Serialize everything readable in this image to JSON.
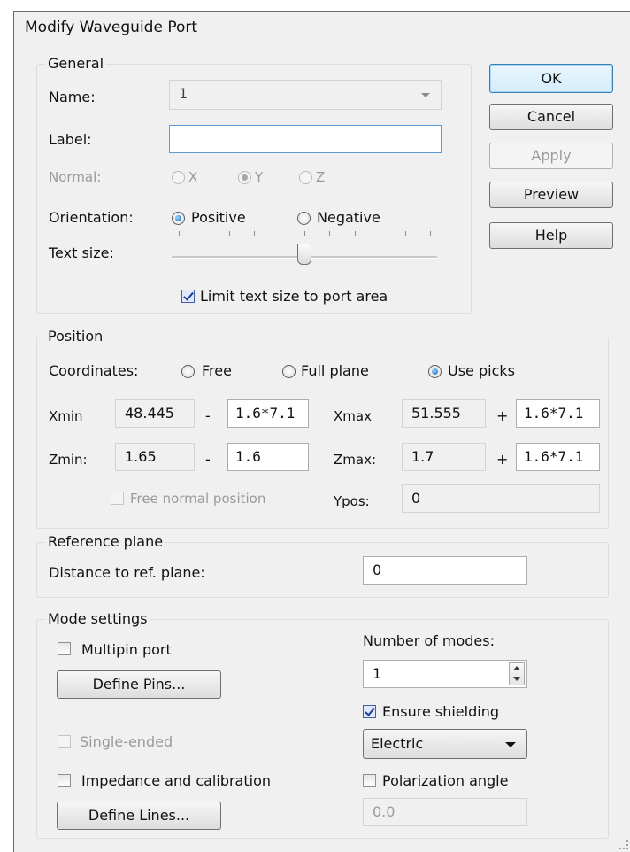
{
  "window": {
    "title": "Modify Waveguide Port"
  },
  "buttons": {
    "ok": "OK",
    "cancel": "Cancel",
    "apply": "Apply",
    "preview": "Preview",
    "help": "Help"
  },
  "general": {
    "legend": "General",
    "name_label": "Name:",
    "name_value": "1",
    "label_label": "Label:",
    "label_value": "",
    "normal_label": "Normal:",
    "normal_options": [
      "X",
      "Y",
      "Z"
    ],
    "normal_selected": "Y",
    "orientation_label": "Orientation:",
    "orientation_options": [
      "Positive",
      "Negative"
    ],
    "orientation_selected": "Positive",
    "text_size_label": "Text size:",
    "text_size_level": 0.5,
    "limit_text_label": "Limit text size to port area",
    "limit_text_checked": true
  },
  "position": {
    "legend": "Position",
    "coordinates_label": "Coordinates:",
    "coordinate_options": [
      "Free",
      "Full plane",
      "Use picks"
    ],
    "coordinate_selected": "Use picks",
    "xmin_label": "Xmin",
    "xmin_value": "48.445",
    "xmin_minus": "-",
    "xmin_offset": "1.6*7.1",
    "xmax_label": "Xmax",
    "xmax_value": "51.555",
    "xmax_plus": "+",
    "xmax_offset": "1.6*7.1",
    "zmin_label": "Zmin:",
    "zmin_value": "1.65",
    "zmin_minus": "-",
    "zmin_offset": "1.6",
    "zmax_label": "Zmax:",
    "zmax_value": "1.7",
    "zmax_plus": "+",
    "zmax_offset": "1.6*7.1",
    "free_normal_label": "Free normal position",
    "free_normal_checked": false,
    "ypos_label": "Ypos:",
    "ypos_value": "0"
  },
  "reference": {
    "legend": "Reference plane",
    "distance_label": "Distance to ref. plane:",
    "distance_value": "0"
  },
  "mode": {
    "legend": "Mode settings",
    "multipin_label": "Multipin port",
    "multipin_checked": false,
    "define_pins": "Define Pins...",
    "num_modes_label": "Number of modes:",
    "num_modes_value": "1",
    "ensure_shielding_label": "Ensure shielding",
    "ensure_shielding_checked": true,
    "single_ended_label": "Single-ended",
    "single_ended_checked": false,
    "shielding_type": "Electric",
    "impedance_label": "Impedance and calibration",
    "impedance_checked": false,
    "polarization_label": "Polarization angle",
    "polarization_checked": false,
    "define_lines": "Define Lines...",
    "polarization_value": "0.0"
  },
  "colors": {
    "dialog_bg": "#f0f0f0",
    "group_border": "#d5dfe5",
    "radio_dot": "#1464b4",
    "disabled_text": "#9a9a9a"
  }
}
